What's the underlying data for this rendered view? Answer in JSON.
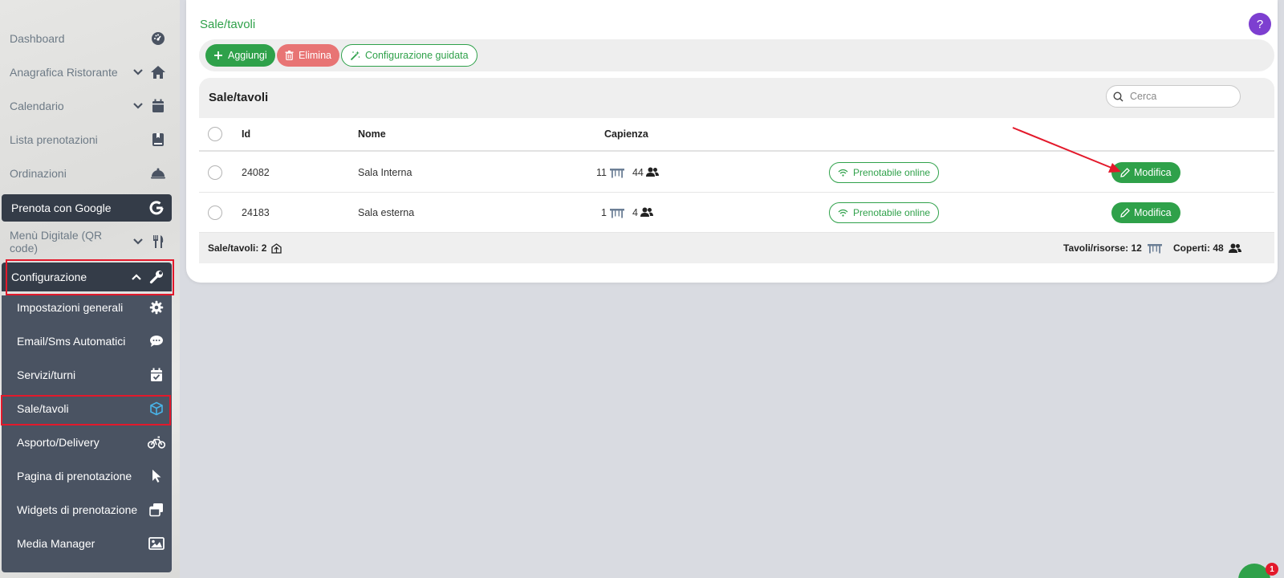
{
  "sidebar": {
    "items": [
      {
        "label": "Dashboard"
      },
      {
        "label": "Anagrafica Ristorante"
      },
      {
        "label": "Calendario"
      },
      {
        "label": "Lista prenotazioni"
      },
      {
        "label": "Ordinazioni"
      },
      {
        "label": "Prenota con Google"
      },
      {
        "label": "Menù Digitale (QR code)"
      },
      {
        "label": "Configurazione"
      }
    ],
    "subitems": [
      {
        "label": "Impostazioni generali"
      },
      {
        "label": "Email/Sms Automatici"
      },
      {
        "label": "Servizi/turni"
      },
      {
        "label": "Sale/tavoli"
      },
      {
        "label": "Asporto/Delivery"
      },
      {
        "label": "Pagina di prenotazione"
      },
      {
        "label": "Widgets di prenotazione"
      },
      {
        "label": "Media Manager"
      }
    ]
  },
  "page": {
    "title": "Sale/tavoli",
    "help_label": "?"
  },
  "toolbar": {
    "add_label": "Aggiungi",
    "delete_label": "Elimina",
    "wizard_label": "Configurazione guidata"
  },
  "table": {
    "title": "Sale/tavoli",
    "search_placeholder": "Cerca",
    "columns": {
      "id": "Id",
      "name": "Nome",
      "capacity": "Capienza"
    },
    "rows": [
      {
        "id": "24082",
        "name": "Sala Interna",
        "tables": "11",
        "covers": "44",
        "online_label": "Prenotabile online",
        "edit_label": "Modifica"
      },
      {
        "id": "24183",
        "name": "Sala esterna",
        "tables": "1",
        "covers": "4",
        "online_label": "Prenotabile online",
        "edit_label": "Modifica"
      }
    ],
    "footer": {
      "rooms_label": "Sale/tavoli: 2",
      "resources_label": "Tavoli/risorse: 12",
      "covers_label": "Coperti: 48"
    }
  },
  "chat": {
    "badge": "1"
  },
  "colors": {
    "accent": "#2fa14a",
    "danger": "#e87474",
    "sidebar_dark": "#343c48",
    "sidebar_sub": "#4a5362",
    "highlight": "#e3192b",
    "help": "#7d3fd0"
  }
}
